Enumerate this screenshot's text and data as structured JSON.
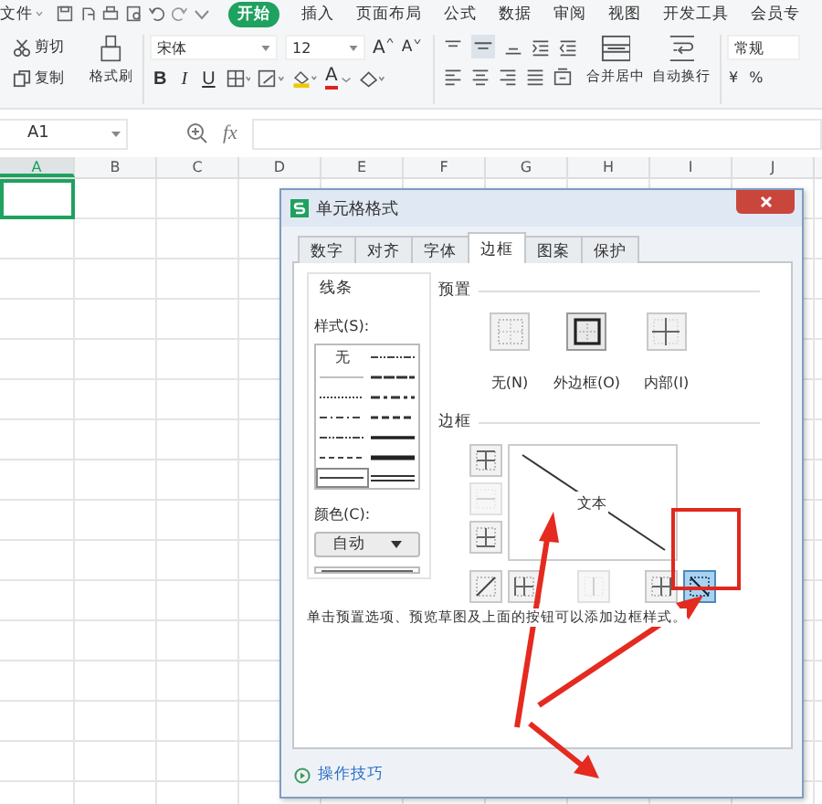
{
  "menu": [
    {
      "label": "文件",
      "selected": false,
      "dropdown": true
    },
    {
      "label": "开始",
      "selected": true
    },
    {
      "label": "插入",
      "selected": false
    },
    {
      "label": "页面布局",
      "selected": false
    },
    {
      "label": "公式",
      "selected": false
    },
    {
      "label": "数据",
      "selected": false
    },
    {
      "label": "审阅",
      "selected": false
    },
    {
      "label": "视图",
      "selected": false
    },
    {
      "label": "开发工具",
      "selected": false
    },
    {
      "label": "会员专",
      "selected": false
    }
  ],
  "toolbar": {
    "cut": "剪切",
    "copy": "复制",
    "format_painter": "格式刷",
    "font": "宋体",
    "font_size": "12",
    "grow_font": "A",
    "shrink_font": "A",
    "bold": "B",
    "italic": "I",
    "underline": "U",
    "font_color": "A",
    "merge": "合并居中",
    "wrap": "自动换行",
    "number_format": "常规",
    "currency": "¥",
    "percent": "%"
  },
  "formula_bar": {
    "name_box": "A1",
    "fx": "fx"
  },
  "columns": [
    "A",
    "B",
    "C",
    "D",
    "E",
    "F",
    "G",
    "H",
    "I",
    "J"
  ],
  "dialog": {
    "title": "单元格格式",
    "tabs": [
      {
        "label": "数字",
        "selected": false
      },
      {
        "label": "对齐",
        "selected": false
      },
      {
        "label": "字体",
        "selected": false
      },
      {
        "label": "边框",
        "selected": true
      },
      {
        "label": "图案",
        "selected": false
      },
      {
        "label": "保护",
        "selected": false
      }
    ],
    "line_group": "线条",
    "style_label": "样式(S):",
    "line_styles": [
      {
        "kind": "none",
        "label": "无",
        "selected": false
      },
      {
        "kind": "dashdotdot",
        "selected": false
      },
      {
        "kind": "hair",
        "selected": false
      },
      {
        "kind": "mediumdash",
        "selected": false
      },
      {
        "kind": "dotted",
        "selected": false
      },
      {
        "kind": "mediumdashdot",
        "selected": false
      },
      {
        "kind": "dashdot",
        "selected": false
      },
      {
        "kind": "mediumdashed",
        "selected": false
      },
      {
        "kind": "dashdotdot",
        "selected": false
      },
      {
        "kind": "medium",
        "selected": false
      },
      {
        "kind": "dashed",
        "selected": false
      },
      {
        "kind": "thick",
        "selected": false
      },
      {
        "kind": "thin",
        "selected": true
      },
      {
        "kind": "double",
        "selected": false
      }
    ],
    "color_label": "颜色(C):",
    "color_value": "自动",
    "preset_label": "预置",
    "presets": [
      {
        "kind": "none",
        "label": "无(N)"
      },
      {
        "kind": "outline",
        "label": "外边框(O)"
      },
      {
        "kind": "inside",
        "label": "内部(I)"
      }
    ],
    "border_label": "边框",
    "preview_text": "文本",
    "border_buttons": [
      {
        "kind": "top",
        "selected": false,
        "disabled": false
      },
      {
        "kind": "middle-h",
        "selected": false,
        "disabled": true
      },
      {
        "kind": "bottom",
        "selected": false,
        "disabled": false
      },
      {
        "kind": "diag-up",
        "selected": false,
        "disabled": false
      },
      {
        "kind": "left",
        "selected": false,
        "disabled": false
      },
      {
        "kind": "middle-v",
        "selected": false,
        "disabled": true
      },
      {
        "kind": "right",
        "selected": false,
        "disabled": false
      },
      {
        "kind": "diag-down",
        "selected": true,
        "disabled": false
      }
    ],
    "hint": "单击预置选项、预览草图及上面的按钮可以添加边框样式。",
    "tips_link": "操作技巧"
  }
}
